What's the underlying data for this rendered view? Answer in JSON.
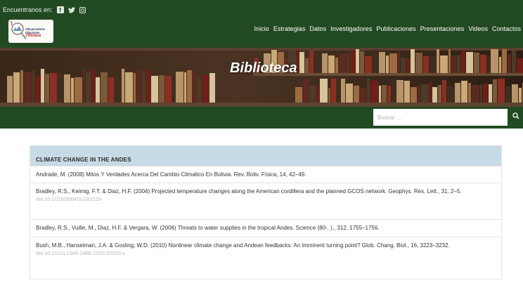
{
  "topbar": {
    "follow_label": "Encuentranos en:",
    "social": [
      {
        "icon": "facebook-icon",
        "glyph": "f"
      },
      {
        "icon": "twitter-icon",
        "glyph": "🐦"
      },
      {
        "icon": "instagram-icon",
        "glyph": ""
      }
    ]
  },
  "logo": {
    "line1": "Observatorio",
    "line2": "Glaciares",
    "line3": "Titicaca"
  },
  "nav": {
    "items": [
      "Inicio",
      "Estrategias",
      "Datos",
      "Investigadores",
      "Publicaciones",
      "Presentaciones",
      "Videos",
      "Contactos"
    ]
  },
  "banner": {
    "title": "Biblioteca"
  },
  "search": {
    "placeholder": "Buscar ...",
    "value": ""
  },
  "section": {
    "title": "CLIMATE CHANGE IN THE ANDES",
    "references": [
      {
        "text": "Andrade, M. (2008) Mitos Y Verdades Acerca Del Cambio Climatico En Bolivia. Rev. Boliv. Física, 14, 42–49.",
        "doi": ""
      },
      {
        "text": "Bradley, R.S., Keimig, F.T. & Diaz, H.F. (2004) Projected temperature changes along the American cordillera and the planned GCOS network. Geophys. Res. Lett., 31, 2–5.",
        "doi": "doi:10.1029/2004GL020229"
      },
      {
        "text": "Bradley, R.S., Vuille, M., Diaz, H.F. & Vergara, W. (2006) Threats to water supplies in the tropical Andes. Science (80-. )., 312, 1755–1756.",
        "doi": ""
      },
      {
        "text": "Bush, M.B., Hanselman, J.A. & Gosling, W.D. (2010) Nonlinear climate change and Andean feedbacks: An imminent turning point? Glob. Chang. Biol., 16, 3223–3232.",
        "doi": "doi:10.1111/j.1365-2486.2010.02203.x"
      }
    ]
  },
  "colors": {
    "header_green": "#224a22",
    "section_header_blue": "#c7dbe6"
  }
}
